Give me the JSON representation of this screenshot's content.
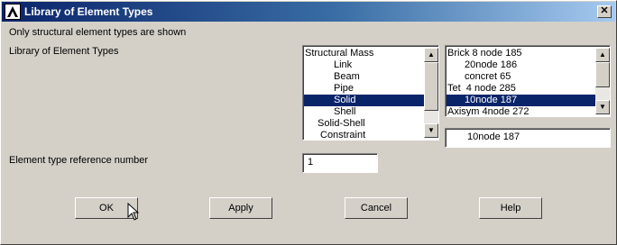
{
  "window": {
    "title": "Library of Element Types",
    "app_icon": "ansys-logo-icon",
    "close_glyph": "✕"
  },
  "info_text": "Only structural element types are shown",
  "library_label": "Library of Element Types",
  "categories": {
    "items": [
      "Structural Mass",
      "Link",
      "Beam",
      "Pipe",
      "Solid",
      "Shell",
      "Solid-Shell",
      "Constraint"
    ],
    "selected": "Solid"
  },
  "element_types": {
    "items": [
      "Brick 8 node 185",
      "20node 186",
      "concret 65",
      "Tet  4 node 285",
      "10node 187",
      "Axisym 4node 272"
    ],
    "selected": "10node 187"
  },
  "selected_element_display": "10node 187",
  "ref_number": {
    "label": "Element type reference number",
    "value": "1"
  },
  "buttons": {
    "ok": "OK",
    "apply": "Apply",
    "cancel": "Cancel",
    "help": "Help"
  },
  "colors": {
    "selection": "#0a246a",
    "dialog_bg": "#d4d0c8",
    "titlebar_start": "#0a246a",
    "titlebar_end": "#a6caf0"
  }
}
